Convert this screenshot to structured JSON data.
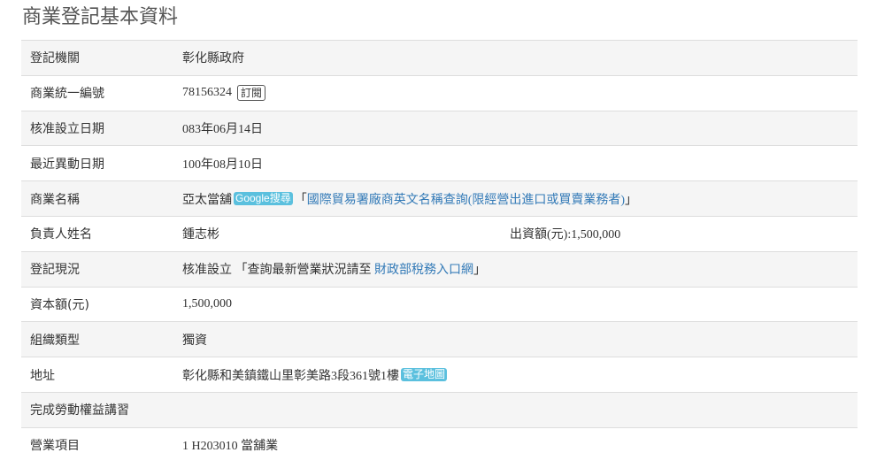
{
  "page": {
    "title": "商業登記基本資料"
  },
  "rows": {
    "agency": {
      "label": "登記機關",
      "value": "彰化縣政府"
    },
    "uid": {
      "label": "商業統一編號",
      "value": "78156324",
      "subscribe": "訂閱"
    },
    "approve_date": {
      "label": "核准設立日期",
      "value": "083年06月14日"
    },
    "change_date": {
      "label": "最近異動日期",
      "value": "100年08月10日"
    },
    "name": {
      "label": "商業名稱",
      "value": "亞太當舖",
      "google": "Google搜尋",
      "q_open": "「",
      "query": "國際貿易署廠商英文名稱查詢(限經營出進口或買賣業務者)",
      "q_close": "」"
    },
    "owner": {
      "label": "負責人姓名",
      "value": "鍾志彬",
      "capital_text": "出資額(元):1,500,000"
    },
    "status": {
      "label": "登記現況",
      "value": "核准設立",
      "prefix": " 「查詢最新營業狀況請至 ",
      "link": "財政部稅務入口網",
      "suffix": "」"
    },
    "capital": {
      "label": "資本額(元)",
      "value": "1,500,000"
    },
    "org_type": {
      "label": "組織類型",
      "value": "獨資"
    },
    "address": {
      "label": "地址",
      "value": "彰化縣和美鎮鐵山里彰美路3段361號1樓",
      "map": "電子地圖"
    },
    "labor": {
      "label": "完成勞動權益講習",
      "value": ""
    },
    "business": {
      "label": "營業項目",
      "value": "1 H203010 當舖業"
    }
  }
}
